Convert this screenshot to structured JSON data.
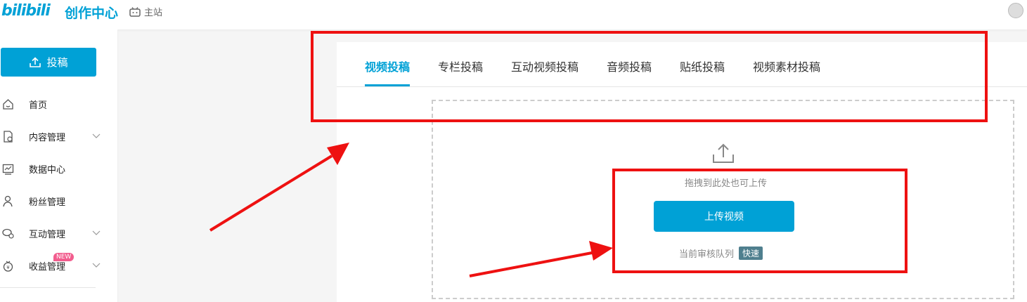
{
  "header": {
    "logo_text": "bilibili",
    "logo_subtitle": "创作中心",
    "home_link": "主站"
  },
  "sidebar": {
    "upload_button": "投稿",
    "items": [
      {
        "label": "首页",
        "icon": "home-icon"
      },
      {
        "label": "内容管理",
        "icon": "content-icon",
        "expandable": true
      },
      {
        "label": "数据中心",
        "icon": "chart-icon"
      },
      {
        "label": "粉丝管理",
        "icon": "user-icon"
      },
      {
        "label": "互动管理",
        "icon": "chat-icon",
        "expandable": true
      },
      {
        "label": "收益管理",
        "icon": "money-icon",
        "expandable": true,
        "badge": "NEW"
      }
    ]
  },
  "tabs": [
    {
      "label": "视频投稿",
      "active": true
    },
    {
      "label": "专栏投稿"
    },
    {
      "label": "互动视频投稿"
    },
    {
      "label": "音频投稿"
    },
    {
      "label": "贴纸投稿"
    },
    {
      "label": "视频素材投稿"
    }
  ],
  "upload_area": {
    "drag_hint": "拖拽到此处也可上传",
    "upload_button": "上传视频",
    "queue_label": "当前审核队列",
    "queue_badge": "快速"
  },
  "colors": {
    "accent": "#00a1d6",
    "annotation": "#ee1111",
    "badge_new": "#f25d8e",
    "queue_badge": "#4f7f8e"
  }
}
